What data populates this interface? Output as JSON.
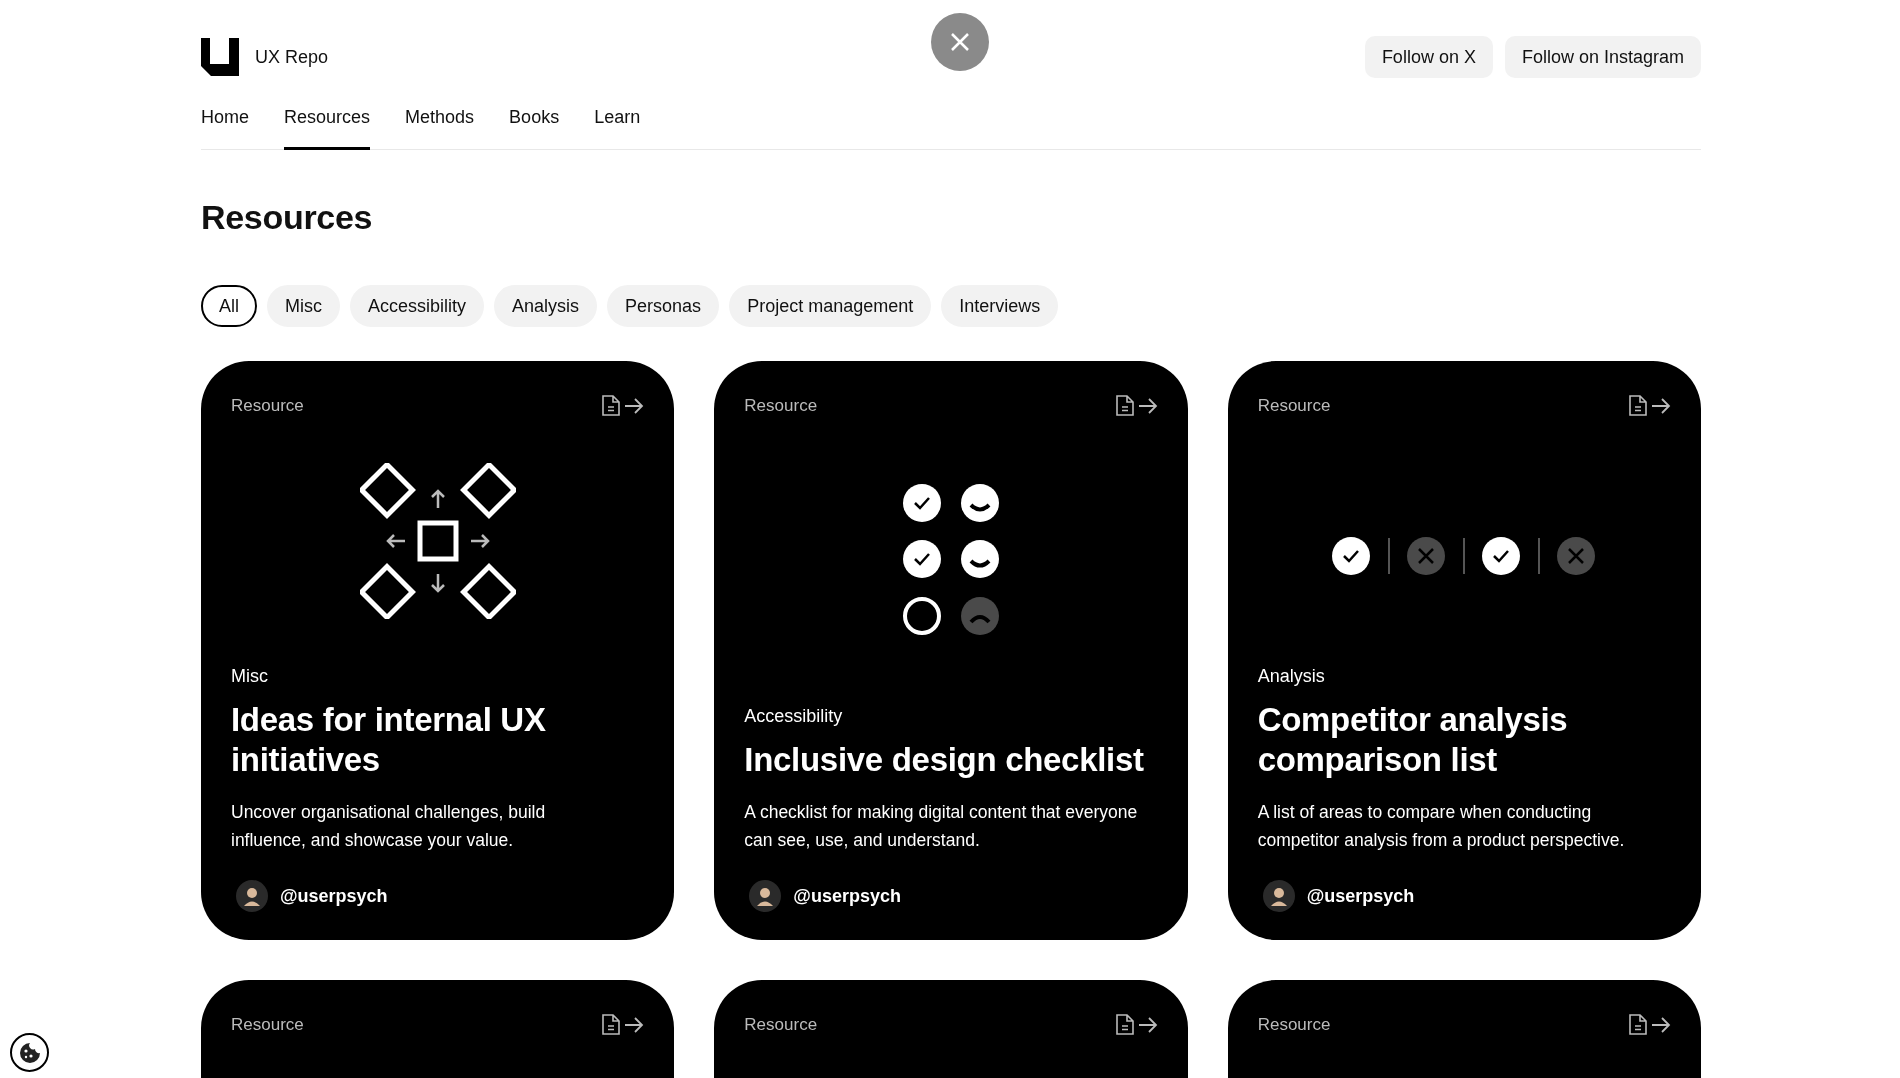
{
  "brand": {
    "name": "UX Repo"
  },
  "header_buttons": [
    "Follow on X",
    "Follow on Instagram"
  ],
  "nav": [
    {
      "label": "Home",
      "selected": false
    },
    {
      "label": "Resources",
      "selected": true
    },
    {
      "label": "Methods",
      "selected": false
    },
    {
      "label": "Books",
      "selected": false
    },
    {
      "label": "Learn",
      "selected": false
    }
  ],
  "page_title": "Resources",
  "filters": [
    {
      "label": "All",
      "selected": true
    },
    {
      "label": "Misc",
      "selected": false
    },
    {
      "label": "Accessibility",
      "selected": false
    },
    {
      "label": "Analysis",
      "selected": false
    },
    {
      "label": "Personas",
      "selected": false
    },
    {
      "label": "Project management",
      "selected": false
    },
    {
      "label": "Interviews",
      "selected": false
    }
  ],
  "cards": [
    {
      "label": "Resource",
      "kind": "flow",
      "category": "Misc",
      "title": "Ideas for internal UX initiatives",
      "description": "Uncover organisational challenges, build influence, and showcase your value.",
      "author": "@userpsych"
    },
    {
      "label": "Resource",
      "kind": "checklist",
      "category": "Accessibility",
      "title": "Inclusive design checklist",
      "description": "A checklist for making digital content that everyone can see, use, and understand.",
      "author": "@userpsych"
    },
    {
      "label": "Resource",
      "kind": "comparison",
      "category": "Analysis",
      "title": "Competitor analysis comparison list",
      "description": "A list of areas to compare when conducting competitor analysis from a product perspective.",
      "author": "@userpsych"
    },
    {
      "label": "Resource",
      "kind": "partial"
    },
    {
      "label": "Resource",
      "kind": "partial"
    },
    {
      "label": "Resource",
      "kind": "partial"
    }
  ]
}
